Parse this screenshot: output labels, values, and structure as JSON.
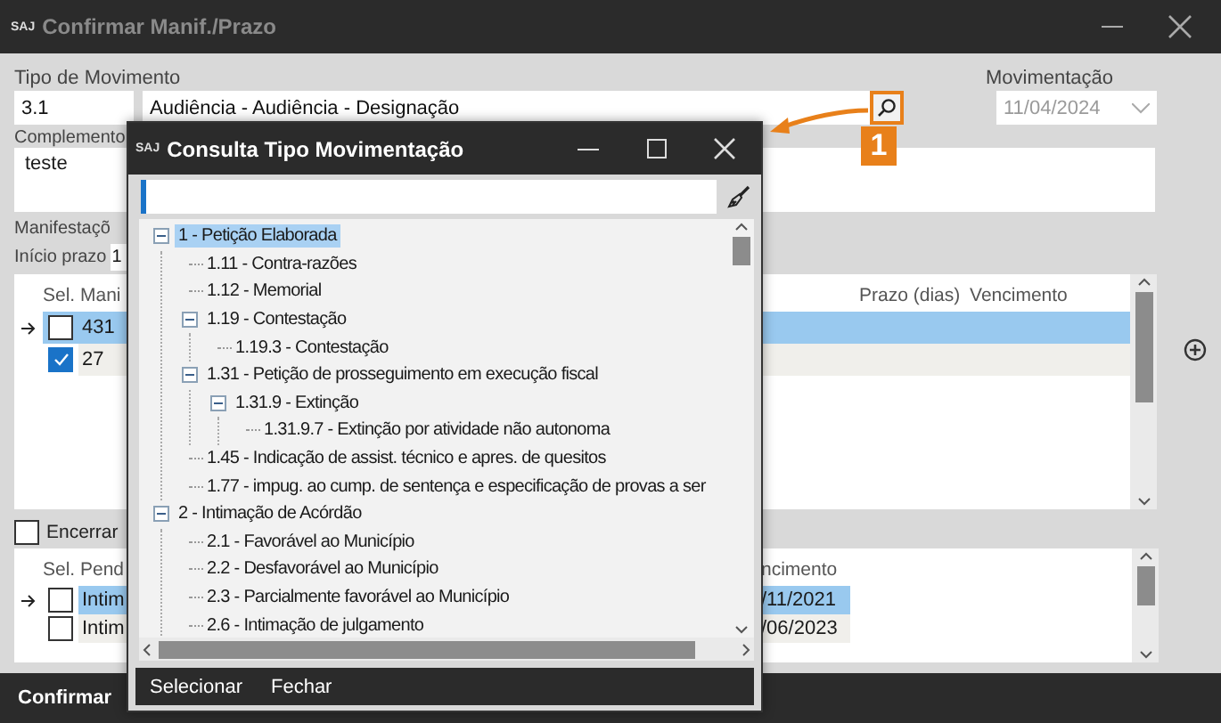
{
  "window": {
    "logo": "SAJ",
    "title": "Confirmar Manif./Prazo"
  },
  "form": {
    "tipo_label": "Tipo de Movimento",
    "tipo_code": "3.1",
    "tipo_description": "Audiência - Audiência - Designação",
    "movimentacao_label": "Movimentação",
    "movimentacao_date": "11/04/2024",
    "movimentacao_disabled": true,
    "complemento_label": "Complemento",
    "complemento_value": "teste",
    "manifestacoes_label": "Manifestaçõ",
    "inicio_label": "Início prazo",
    "inicio_value": "1"
  },
  "manifestacoes_table": {
    "columns": [
      "Sel.",
      "Mani",
      "Prazo (dias)",
      "Vencimento"
    ],
    "rows": [
      {
        "current": true,
        "selected": true,
        "checked": false,
        "value": "431"
      },
      {
        "current": false,
        "selected": false,
        "checked": true,
        "value": "27"
      }
    ]
  },
  "encerrar": {
    "label": "Encerrar",
    "checked": false
  },
  "pendencias_table": {
    "columns": [
      "Sel.",
      "Pend",
      "ncimento"
    ],
    "rows": [
      {
        "current": true,
        "selected": true,
        "checked": false,
        "name": "Intim",
        "date": "/11/2021"
      },
      {
        "current": false,
        "selected": false,
        "checked": false,
        "name": "Intim",
        "date": "/06/2023"
      }
    ]
  },
  "footer": {
    "buttons": [
      "Confirmar"
    ]
  },
  "dialog": {
    "logo": "SAJ",
    "title": "Consulta Tipo Movimentação",
    "tree": [
      {
        "label": "1 - Petição Elaborada",
        "selected": true,
        "expanded": true,
        "children": [
          {
            "label": "1.11 - Contra-razões",
            "selected": false
          },
          {
            "label": "1.12 - Memorial",
            "selected": false
          },
          {
            "label": "1.19 - Contestação",
            "selected": false,
            "expanded": true,
            "children": [
              {
                "label": "1.19.3 - Contestação",
                "selected": false
              }
            ]
          },
          {
            "label": "1.31 - Petição de prosseguimento em  execução fiscal",
            "selected": false,
            "expanded": true,
            "children": [
              {
                "label": "1.31.9 - Extinção",
                "selected": false,
                "expanded": true,
                "children": [
                  {
                    "label": "1.31.9.7 - Extinção por atividade não autonoma",
                    "selected": false
                  }
                ]
              }
            ]
          },
          {
            "label": "1.45 - Indicação de assist. técnico e apres. de quesitos",
            "selected": false
          },
          {
            "label": "1.77 - impug. ao cump. de sentença e especificação de provas a ser",
            "selected": false
          }
        ]
      },
      {
        "label": "2 - Intimação de Acórdão",
        "selected": false,
        "expanded": true,
        "children": [
          {
            "label": "2.1 - Favorável ao Município",
            "selected": false
          },
          {
            "label": "2.2 - Desfavorável ao Município",
            "selected": false
          },
          {
            "label": "2.3 - Parcialmente favorável ao Município",
            "selected": false
          },
          {
            "label": "2.6 - Intimação de julgamento",
            "selected": false
          }
        ]
      }
    ],
    "buttons": [
      "Selecionar",
      "Fechar"
    ]
  },
  "annotation": {
    "label": "1"
  }
}
